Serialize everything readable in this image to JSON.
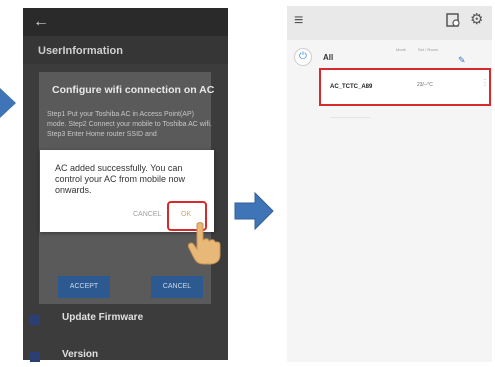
{
  "phone1": {
    "header_text": "UserInformation",
    "config_dialog": {
      "title": "Configure wifi connection on AC",
      "body": "Step1 Put your Toshiba AC in Access Point(AP) mode. Step2 Connect your mobile to Toshiba AC wifi. Step3 Enter Home router SSID and",
      "accept_label": "ACCEPT",
      "cancel_label": "CANCEL"
    },
    "success_dialog": {
      "message": "AC added successfully. You can control your AC from mobile now onwards.",
      "cancel_label": "CANCEL",
      "ok_label": "OK"
    },
    "menu": {
      "update_firmware": "Update Firmware",
      "version": "Version"
    }
  },
  "phone2": {
    "group_label": "All",
    "col_mode": "Mode",
    "col_room": "Set / Room",
    "device": {
      "name": "AC_TCTC_A89",
      "temperature": "23/--°C"
    }
  },
  "colors": {
    "arrow": "#3f74b7",
    "highlight": "#d82a2a",
    "accent_blue": "#3c8ddc"
  },
  "icons": [
    "back-arrow-icon",
    "hand-pointer-icon",
    "menu-icon",
    "power-icon",
    "gear-icon",
    "pin-icon",
    "more-icon"
  ]
}
